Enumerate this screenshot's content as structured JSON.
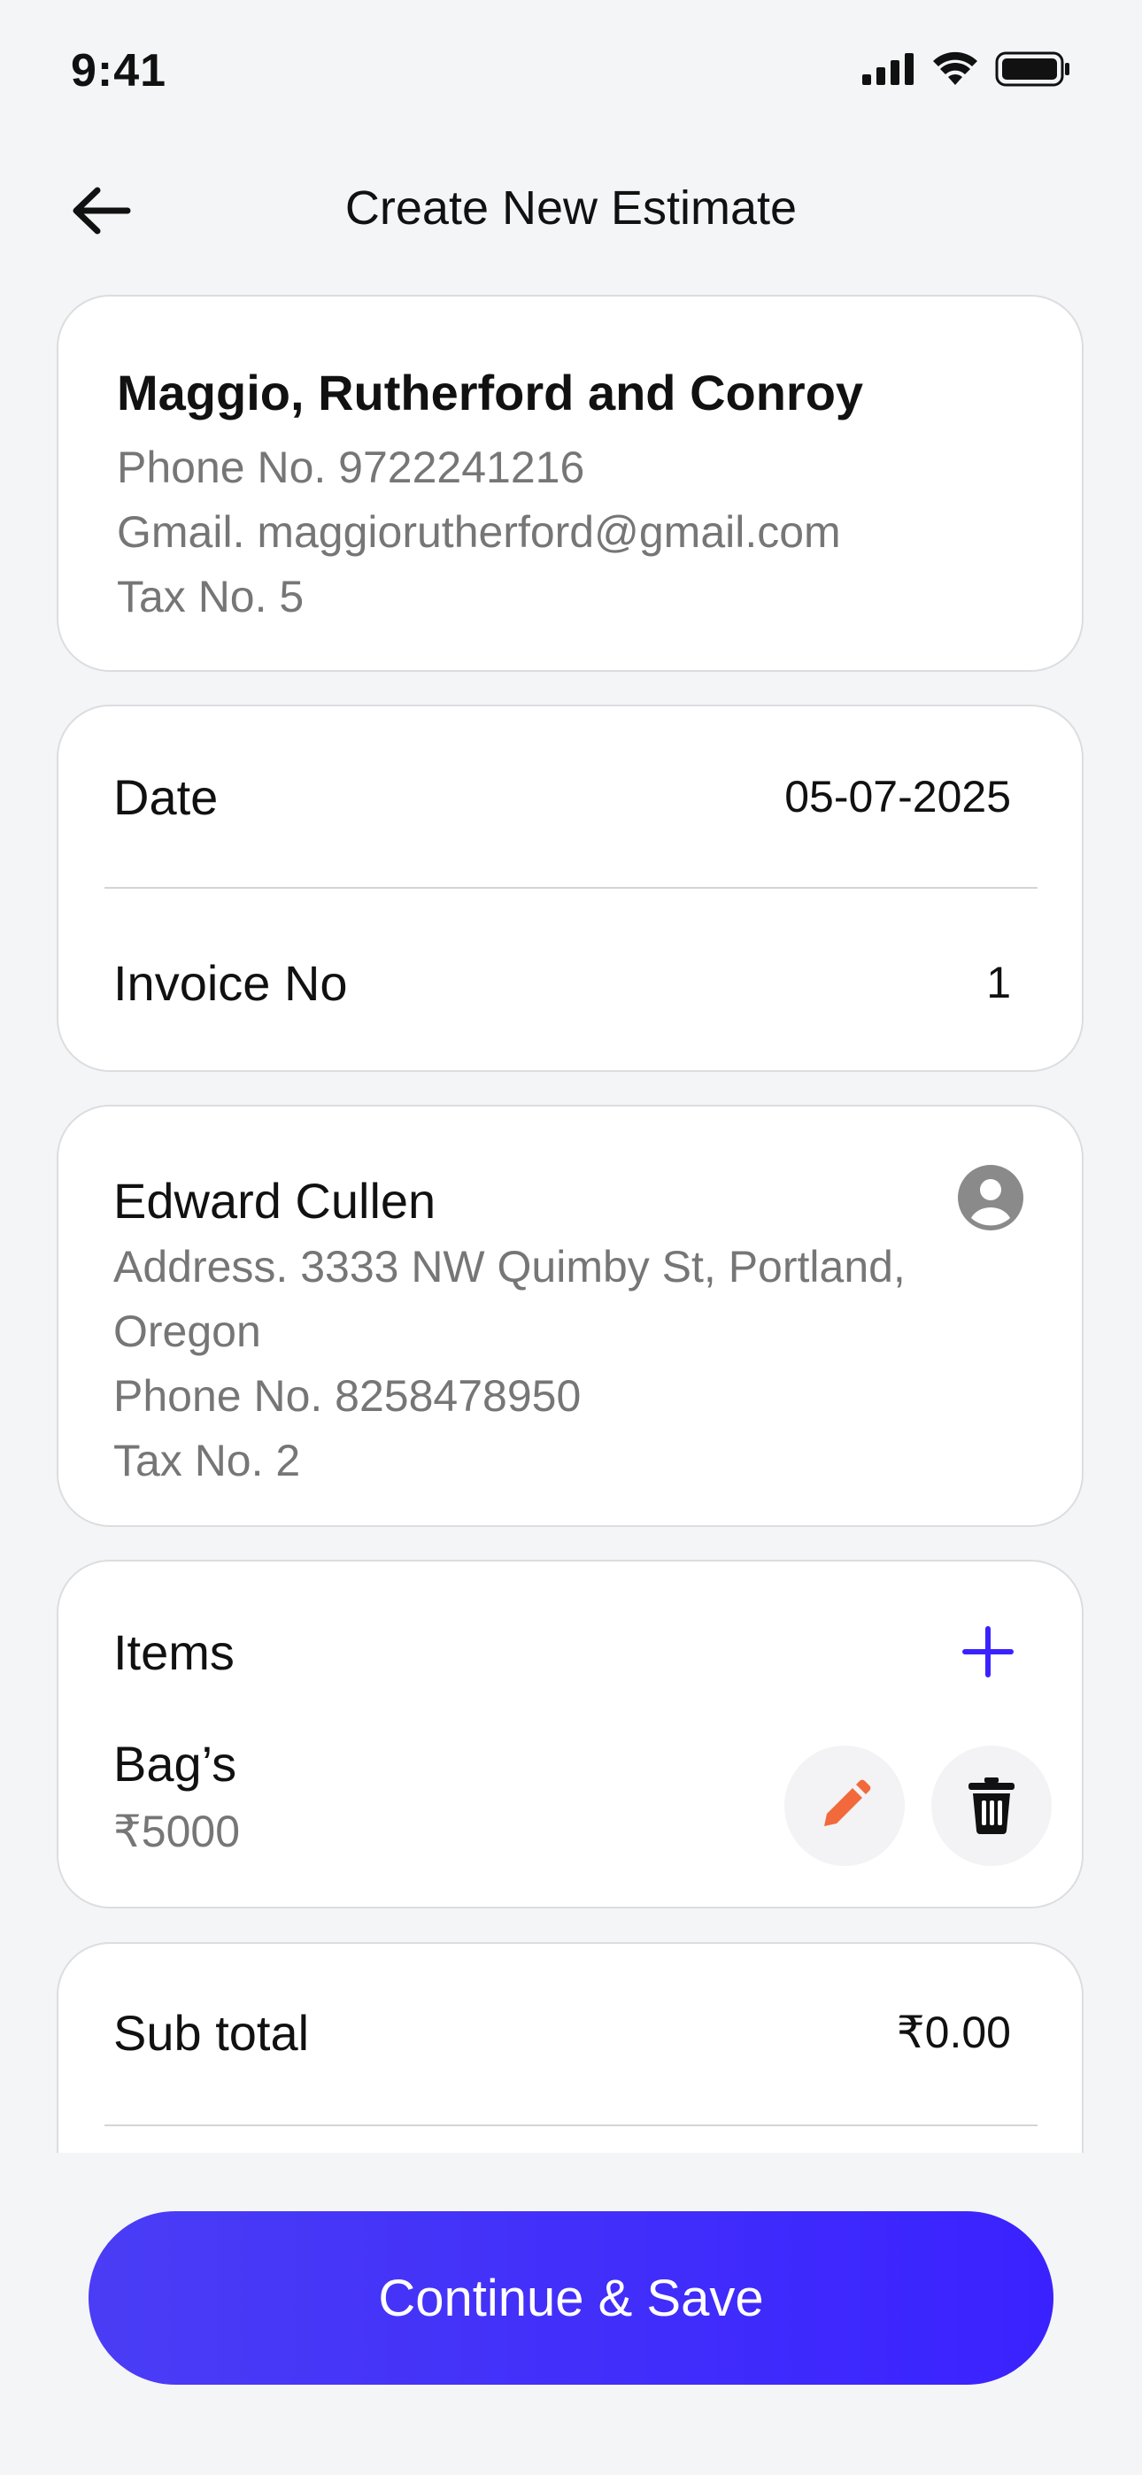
{
  "status": {
    "time": "9:41"
  },
  "header": {
    "title": "Create  New Estimate"
  },
  "company": {
    "name": "Maggio, Rutherford and Conroy",
    "phone": "Phone No. 9722241216",
    "gmail": "Gmail. maggiorutherford@gmail.com",
    "tax": "Tax No. 5"
  },
  "invoice_meta": {
    "date_label": "Date",
    "date_value": "05-07-2025",
    "invoice_label": "Invoice No",
    "invoice_value": "1"
  },
  "client": {
    "name": "Edward Cullen",
    "address_line1": "Address. 3333 NW Quimby St, Portland,",
    "address_line2": "Oregon",
    "phone": "Phone No. 8258478950",
    "tax": "Tax No. 2"
  },
  "items": {
    "title": "Items",
    "list": [
      {
        "name": "Bag’s",
        "price": "₹5000"
      }
    ]
  },
  "summary": {
    "subtotal_label": "Sub total",
    "subtotal_value": "₹0.00"
  },
  "actions": {
    "continue_label": "Continue & Save"
  },
  "colors": {
    "accent": "#3A22FF",
    "edit_icon": "#F26A3B",
    "muted_text": "#767676",
    "background": "#F4F5F7"
  },
  "icons": {
    "back": "arrow-left-icon",
    "avatar": "user-avatar-icon",
    "add": "plus-icon",
    "edit": "pencil-icon",
    "delete": "trash-icon"
  }
}
